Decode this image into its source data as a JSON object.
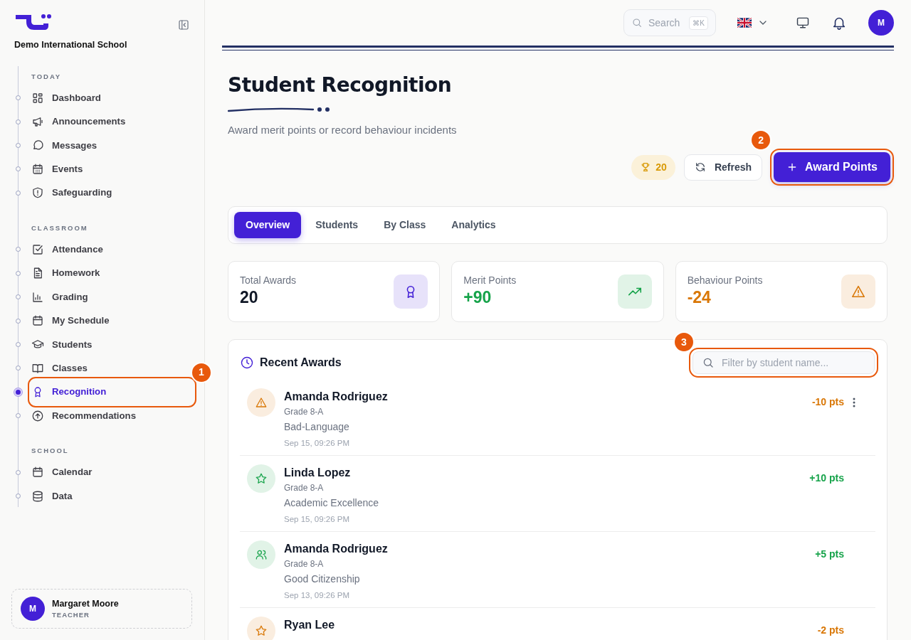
{
  "sidebar": {
    "school_name": "Demo International School",
    "sections": [
      {
        "title": "TODAY",
        "items": [
          {
            "label": "Dashboard",
            "kind": "grid",
            "selected": false
          },
          {
            "label": "Announcements",
            "kind": "megaphone",
            "selected": false
          },
          {
            "label": "Messages",
            "kind": "chat",
            "selected": false
          },
          {
            "label": "Events",
            "kind": "events",
            "selected": false
          },
          {
            "label": "Safeguarding",
            "kind": "shield",
            "selected": false
          }
        ]
      },
      {
        "title": "CLASSROOM",
        "items": [
          {
            "label": "Attendance",
            "kind": "check",
            "selected": false
          },
          {
            "label": "Homework",
            "kind": "document",
            "selected": false
          },
          {
            "label": "Grading",
            "kind": "chart",
            "selected": false
          },
          {
            "label": "My Schedule",
            "kind": "calendar",
            "selected": false
          },
          {
            "label": "Students",
            "kind": "cap",
            "selected": false
          },
          {
            "label": "Classes",
            "kind": "book",
            "selected": false
          },
          {
            "label": "Recognition",
            "kind": "award",
            "selected": true,
            "callout": "1"
          },
          {
            "label": "Recommendations",
            "kind": "arrow",
            "selected": false
          }
        ]
      },
      {
        "title": "SCHOOL",
        "items": [
          {
            "label": "Calendar",
            "kind": "calendar",
            "selected": false
          },
          {
            "label": "Data",
            "kind": "database",
            "selected": false
          }
        ]
      }
    ],
    "user": {
      "initial": "M",
      "name": "Margaret Moore",
      "role": "TEACHER"
    }
  },
  "topbar": {
    "search": {
      "placeholder": "Search",
      "shortcut": "⌘K"
    },
    "avatar_initial": "M"
  },
  "page": {
    "title": "Student Recognition",
    "subtitle": "Award merit points or record behaviour incidents",
    "total_badge": "20",
    "refresh_label": "Refresh",
    "award_button": {
      "label": "Award Points",
      "callout": "2"
    }
  },
  "tabs": [
    {
      "label": "Overview",
      "selected": true
    },
    {
      "label": "Students",
      "selected": false
    },
    {
      "label": "By Class",
      "selected": false
    },
    {
      "label": "Analytics",
      "selected": false
    }
  ],
  "stats": [
    {
      "label": "Total Awards",
      "value": "20",
      "kind": "award",
      "color": "#111827"
    },
    {
      "label": "Merit Points",
      "value": "+90",
      "kind": "trend",
      "color": "#16a34a"
    },
    {
      "label": "Behaviour Points",
      "value": "-24",
      "kind": "warning",
      "color": "#d97706"
    }
  ],
  "recent": {
    "title": "Recent Awards",
    "filter": {
      "placeholder": "Filter by student name...",
      "callout": "3"
    },
    "awards": [
      {
        "student": "Amanda Rodriguez",
        "grade": "Grade 8-A",
        "reason": "Bad-Language",
        "time": "Sep 15, 09:26 PM",
        "points": "-10 pts",
        "kind": "warning",
        "color": "#d97706",
        "menu": true
      },
      {
        "student": "Linda Lopez",
        "grade": "Grade 8-A",
        "reason": "Academic Excellence",
        "time": "Sep 15, 09:26 PM",
        "points": "+10 pts",
        "kind": "star",
        "color": "#16a34a",
        "menu": false
      },
      {
        "student": "Amanda Rodriguez",
        "grade": "Grade 8-A",
        "reason": "Good Citizenship",
        "time": "Sep 13, 09:26 PM",
        "points": "+5 pts",
        "kind": "users",
        "color": "#16a34a",
        "menu": false
      },
      {
        "student": "Ryan Lee",
        "points": "-2 pts",
        "kind": "star",
        "color": "#d97706",
        "menu": false
      }
    ]
  }
}
